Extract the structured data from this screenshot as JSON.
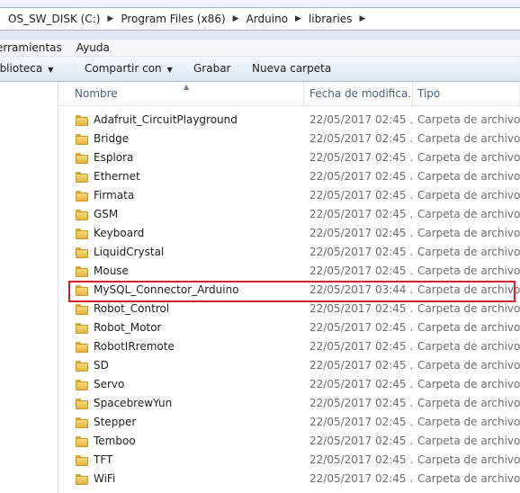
{
  "address": {
    "crumbs": [
      "OS_SW_DISK (C:)",
      "Program Files (x86)",
      "Arduino",
      "libraries"
    ]
  },
  "menu": {
    "items": [
      "erramientas",
      "Ayuda"
    ]
  },
  "toolbar": {
    "library_label": "Biblioteca",
    "share_label": "Compartir con",
    "burn_label": "Grabar",
    "new_folder_label": "Nueva carpeta"
  },
  "columns": {
    "name": "Nombre",
    "date": "Fecha de modifica...",
    "type": "Tipo"
  },
  "files": [
    {
      "name": "Adafruit_CircuitPlayground",
      "date": "22/05/2017 02:45 ...",
      "type": "Carpeta de archivos"
    },
    {
      "name": "Bridge",
      "date": "22/05/2017 02:45 ...",
      "type": "Carpeta de archivos"
    },
    {
      "name": "Esplora",
      "date": "22/05/2017 02:45 ...",
      "type": "Carpeta de archivos"
    },
    {
      "name": "Ethernet",
      "date": "22/05/2017 02:45 ...",
      "type": "Carpeta de archivos"
    },
    {
      "name": "Firmata",
      "date": "22/05/2017 02:45 ...",
      "type": "Carpeta de archivos"
    },
    {
      "name": "GSM",
      "date": "22/05/2017 02:45 ...",
      "type": "Carpeta de archivos"
    },
    {
      "name": "Keyboard",
      "date": "22/05/2017 02:45 ...",
      "type": "Carpeta de archivos"
    },
    {
      "name": "LiquidCrystal",
      "date": "22/05/2017 02:45 ...",
      "type": "Carpeta de archivos"
    },
    {
      "name": "Mouse",
      "date": "22/05/2017 02:45 ...",
      "type": "Carpeta de archivos"
    },
    {
      "name": "MySQL_Connector_Arduino",
      "date": "22/05/2017 03:44 ...",
      "type": "Carpeta de archivos"
    },
    {
      "name": "Robot_Control",
      "date": "22/05/2017 02:45 ...",
      "type": "Carpeta de archivos"
    },
    {
      "name": "Robot_Motor",
      "date": "22/05/2017 02:45 ...",
      "type": "Carpeta de archivos"
    },
    {
      "name": "RobotIRremote",
      "date": "22/05/2017 02:45 ...",
      "type": "Carpeta de archivos"
    },
    {
      "name": "SD",
      "date": "22/05/2017 02:45 ...",
      "type": "Carpeta de archivos"
    },
    {
      "name": "Servo",
      "date": "22/05/2017 02:45 ...",
      "type": "Carpeta de archivos"
    },
    {
      "name": "SpacebrewYun",
      "date": "22/05/2017 02:45 ...",
      "type": "Carpeta de archivos"
    },
    {
      "name": "Stepper",
      "date": "22/05/2017 02:45 ...",
      "type": "Carpeta de archivos"
    },
    {
      "name": "Temboo",
      "date": "22/05/2017 02:45 ...",
      "type": "Carpeta de archivos"
    },
    {
      "name": "TFT",
      "date": "22/05/2017 02:45 ...",
      "type": "Carpeta de archivos"
    },
    {
      "name": "WiFi",
      "date": "22/05/2017 02:45 ...",
      "type": "Carpeta de archivos"
    }
  ],
  "colors": {
    "highlight_border": "#d2232a",
    "folder_fill": "#f8d775",
    "header_text": "#4c607a"
  }
}
